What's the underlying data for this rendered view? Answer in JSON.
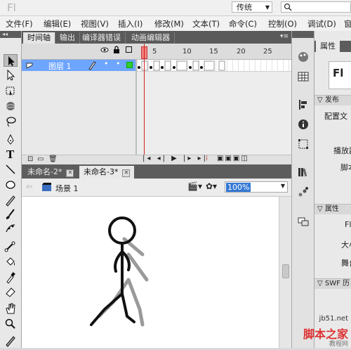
{
  "app": {
    "logo": "Fl",
    "workspace": "传统"
  },
  "menu": [
    "文件(F)",
    "编辑(E)",
    "视图(V)",
    "插入(I)",
    "修改(M)",
    "文本(T)",
    "命令(C)",
    "控制(O)",
    "调试(D)",
    "窗"
  ],
  "timeline_panel": {
    "tabs": [
      "时间轴",
      "输出",
      "编译器错误",
      "动画编辑器"
    ],
    "frame_numbers": [
      "1",
      "5",
      "10",
      "15",
      "20",
      "25"
    ],
    "layer": {
      "name": "图层 1"
    }
  },
  "documents": {
    "tabs": [
      "未命名-2*",
      "未命名-3*"
    ],
    "close_label": "✕"
  },
  "editbar": {
    "scene": "场景 1",
    "zoom": "100%"
  },
  "properties": {
    "tab": "属性",
    "doc_label": "Fl",
    "sections": [
      "发布",
      "属性",
      "SWF 历"
    ],
    "rows": [
      "配置文",
      "播放器",
      "脚本",
      "Fl",
      "大小",
      "舞台"
    ]
  },
  "watermark": {
    "url": "jb51.net",
    "name": "脚本之家",
    "sub": "教程网"
  },
  "colors": {
    "layer_highlight": "#6ea5ff",
    "playhead": "#d41e1e",
    "zoom_highlight": "#3478d4"
  }
}
